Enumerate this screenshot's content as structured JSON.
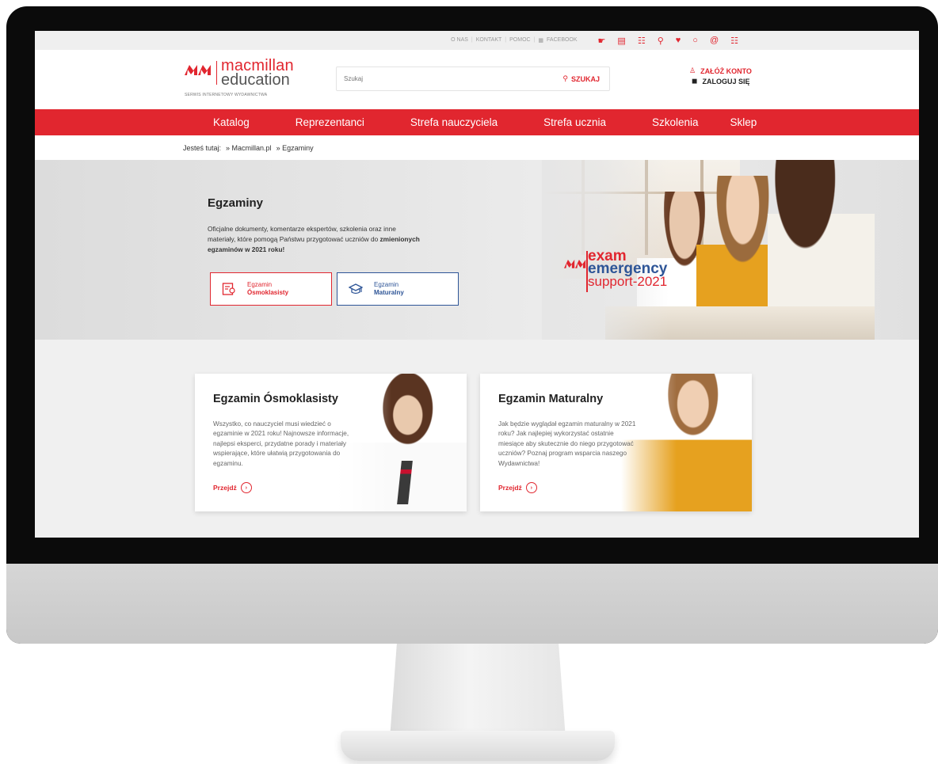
{
  "topbar": {
    "links": [
      "O NAS",
      "KONTAKT",
      "POMOC",
      "FACEBOOK"
    ],
    "icons": [
      "hand-icon",
      "bag-icon",
      "book-icon",
      "pin-icon",
      "heart-icon",
      "chat-icon",
      "at-icon",
      "cart-icon"
    ]
  },
  "header": {
    "logo_line1": "macmillan",
    "logo_line2": "education",
    "logo_tagline": "SERWIS INTERNETOWY WYDAWNICTWA",
    "search_placeholder": "Szukaj",
    "search_button": "SZUKAJ",
    "register": "ZAŁÓŻ KONTO",
    "login": "ZALOGUJ SIĘ"
  },
  "nav": [
    {
      "label": "Katalog",
      "dropdown": false
    },
    {
      "label": "Reprezentanci",
      "dropdown": false
    },
    {
      "label": "Strefa nauczyciela",
      "dropdown": true
    },
    {
      "label": "Strefa ucznia",
      "dropdown": false
    },
    {
      "label": "Szkolenia",
      "dropdown": true
    },
    {
      "label": "Sklep",
      "dropdown": true
    }
  ],
  "breadcrumb": {
    "prefix": "Jesteś tutaj:",
    "items": [
      "» Macmillan.pl",
      "» Egzaminy"
    ]
  },
  "hero": {
    "title": "Egzaminy",
    "text_part1": "Oficjalne dokumenty, komentarze ekspertów, szkolenia oraz inne materiały, które pomogą Państwu przygotować uczniów do ",
    "text_bold": "zmienionych egzaminów w 2021 roku!",
    "btn1_line1": "Egzamin",
    "btn1_line2": "Ósmoklasisty",
    "btn2_line1": "Egzamin",
    "btn2_line2": "Maturalny",
    "badge_line1": "exam",
    "badge_line2": "emergency",
    "badge_line3": "support-2021"
  },
  "cards": [
    {
      "title": "Egzamin Ósmoklasisty",
      "text": "Wszystko, co nauczyciel musi wiedzieć o egzaminie w 2021 roku! Najnowsze informacje, najlepsi eksperci, przydatne porady i materiały wspierające, które ułatwią przygotowania do egzaminu.",
      "link": "Przejdź"
    },
    {
      "title": "Egzamin Maturalny",
      "text": "Jak będzie wyglądał egzamin maturalny w 2021 roku? Jak najlepiej wykorzystać ostatnie miesiące aby skutecznie do niego przygotować uczniów? Poznaj program wsparcia naszego Wydawnictwa!",
      "link": "Przejdź"
    }
  ],
  "colors": {
    "brand_red": "#e1262f",
    "brand_blue": "#2e5597"
  }
}
